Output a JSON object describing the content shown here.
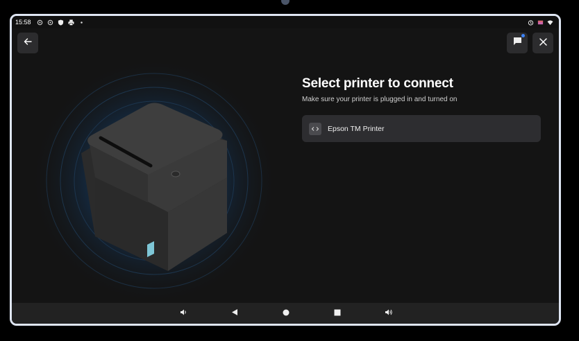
{
  "status_bar": {
    "time": "15:58",
    "left_icons": [
      "settings-icon",
      "settings-icon",
      "shield-icon",
      "print-icon",
      "dot-icon"
    ],
    "right_icons": [
      "alarm-icon",
      "sim-icon",
      "wifi-icon"
    ]
  },
  "header": {
    "back_icon": "arrow-left-icon",
    "chat_icon": "chat-icon",
    "close_icon": "close-icon",
    "notification_color": "#3b82f6"
  },
  "main": {
    "title": "Select printer to connect",
    "subtitle": "Make sure your printer is plugged in and turned on",
    "printers": [
      {
        "label": "Epson TM Printer",
        "icon": "connection-icon"
      }
    ]
  },
  "nav_bar": {
    "buttons": [
      "volume-down-icon",
      "back-icon",
      "home-icon",
      "recents-icon",
      "volume-up-icon"
    ]
  },
  "colors": {
    "background": "#141414",
    "card": "#2d2d30",
    "glow": "#1e4a78",
    "printer_accent": "#7ec6d6"
  }
}
